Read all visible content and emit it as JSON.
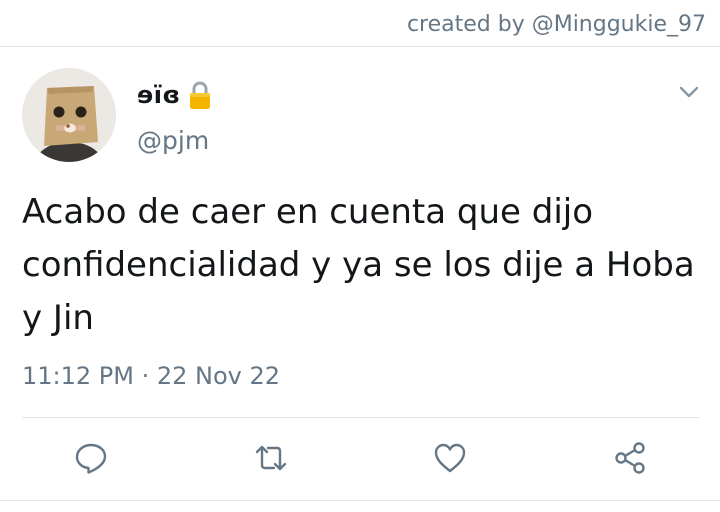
{
  "credit": "created by @Minggukie_97",
  "tweet": {
    "display_name": "ɘïɞ",
    "handle": "@pjm",
    "text": "Acabo de caer en cuenta que dijo confidencialidad y ya se los dije a Hoba y Jin",
    "timestamp": "11:12 PM · 22 Nov 22"
  },
  "icons": {
    "lock": "lock-icon",
    "caret": "chevron-down-icon",
    "reply": "reply-icon",
    "retweet": "retweet-icon",
    "like": "heart-icon",
    "share": "share-icon"
  },
  "colors": {
    "text": "#14171a",
    "secondary": "#657786",
    "divider": "#e1e8ed",
    "lock": "#f5b400"
  }
}
